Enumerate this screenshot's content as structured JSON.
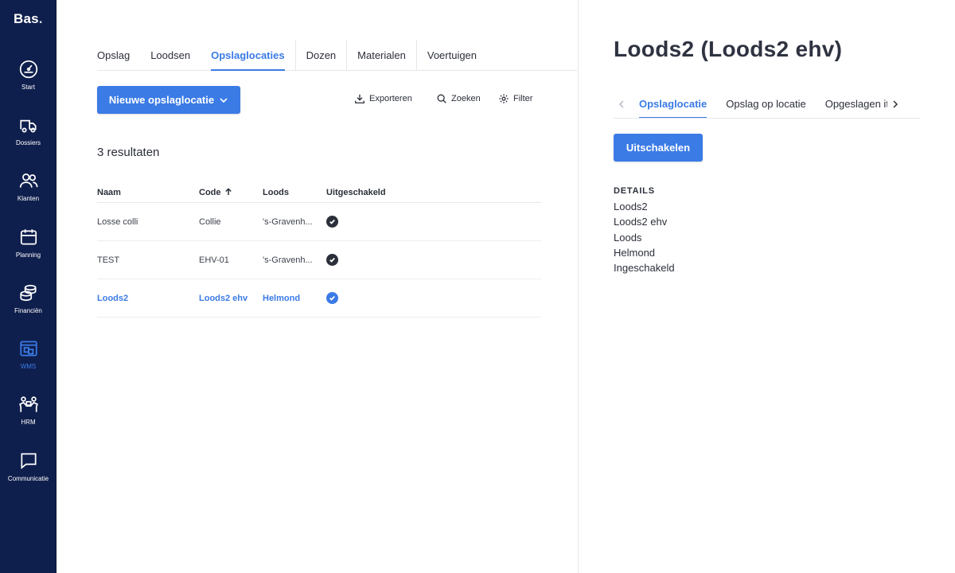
{
  "app": {
    "logo": "Bas",
    "logo_dot": "."
  },
  "sidebar": {
    "items": [
      {
        "label": "Start",
        "icon": "gauge-icon"
      },
      {
        "label": "Dossiers",
        "icon": "truck-icon"
      },
      {
        "label": "Klanten",
        "icon": "users-icon"
      },
      {
        "label": "Planning",
        "icon": "calendar-icon"
      },
      {
        "label": "Financiën",
        "icon": "coins-icon"
      },
      {
        "label": "WMS",
        "icon": "warehouse-icon",
        "active": true
      },
      {
        "label": "HRM",
        "icon": "team-icon"
      },
      {
        "label": "Communicatie",
        "icon": "chat-icon"
      }
    ]
  },
  "main": {
    "tabs": [
      "Opslag",
      "Loodsen",
      "Opslaglocaties",
      "Dozen",
      "Materialen",
      "Voertuigen"
    ],
    "active_tab": "Opslaglocaties",
    "new_button": "Nieuwe opslaglocatie",
    "actions": {
      "export": "Exporteren",
      "search": "Zoeken",
      "filter": "Filter"
    },
    "results": "3 resultaten",
    "table": {
      "headers": [
        "Naam",
        "Code",
        "Loods",
        "Uitgeschakeld"
      ],
      "rows": [
        {
          "naam": "Losse colli",
          "code": "Collie",
          "loods": "'s-Gravenh...",
          "selected": false
        },
        {
          "naam": "TEST",
          "code": "EHV-01",
          "loods": "'s-Gravenh...",
          "selected": false
        },
        {
          "naam": "Loods2",
          "code": "Loods2 ehv",
          "loods": "Helmond",
          "selected": true
        }
      ]
    }
  },
  "detail": {
    "title": "Loods2 (Loods2 ehv)",
    "tabs": [
      "Opslaglocatie",
      "Opslag op locatie",
      "Opgeslagen it"
    ],
    "active_tab": "Opslaglocatie",
    "disable_button": "Uitschakelen",
    "details_heading": "DETAILS",
    "details": [
      "Loods2",
      "Loods2 ehv",
      "Loods",
      "Helmond",
      "Ingeschakeld"
    ]
  },
  "colors": {
    "sidebar": "#0f1f4d",
    "accent": "#3b7be6",
    "text": "#2b2f3a"
  }
}
